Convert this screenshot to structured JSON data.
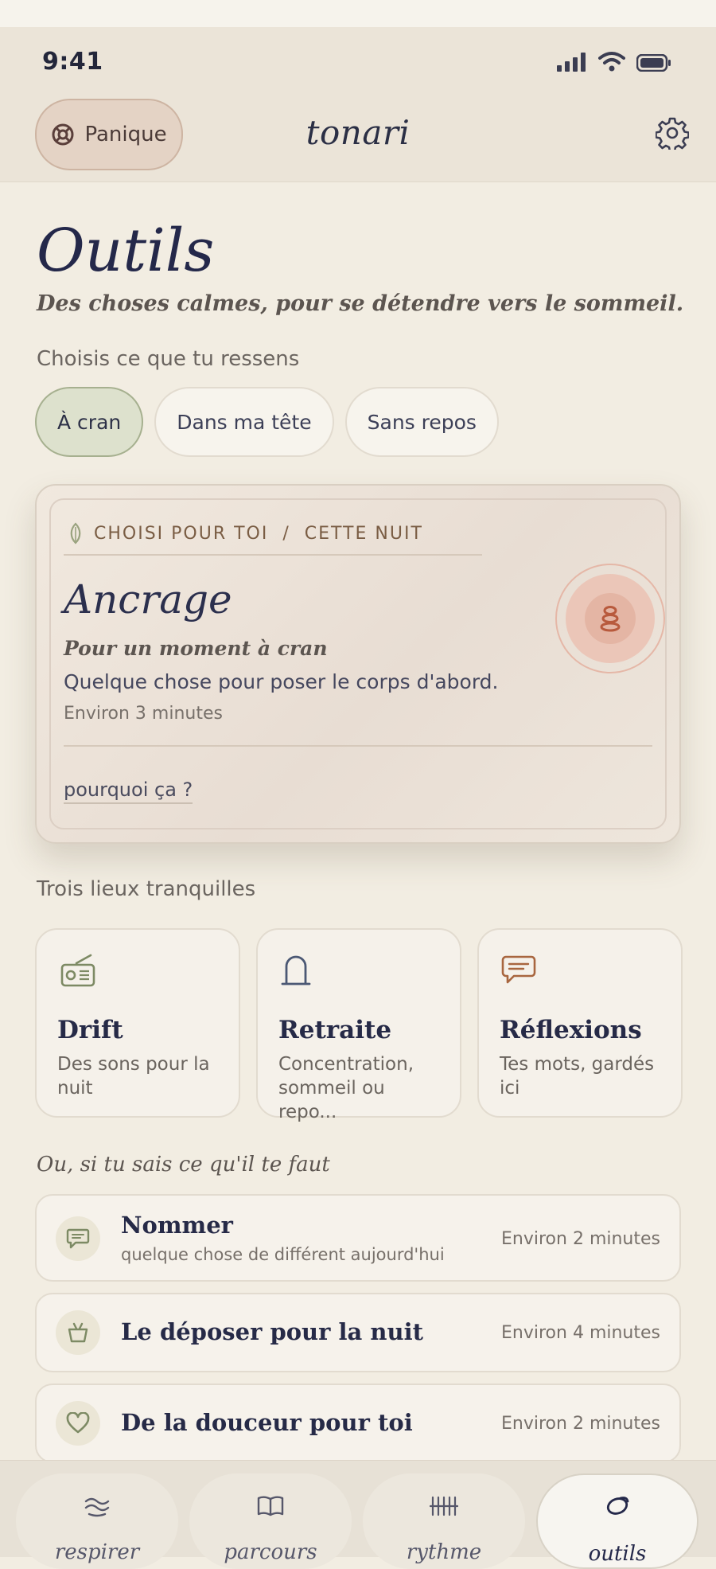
{
  "status": {
    "time": "9:41"
  },
  "header": {
    "panic_label": "Panique",
    "brand": "tonari"
  },
  "page": {
    "title": "Outils",
    "subtitle": "Des choses calmes, pour se détendre vers le sommeil."
  },
  "feelings": {
    "label": "Choisis ce que tu ressens",
    "chips": [
      {
        "label": "À cran",
        "selected": true
      },
      {
        "label": "Dans ma tête",
        "selected": false
      },
      {
        "label": "Sans repos",
        "selected": false
      }
    ]
  },
  "featured": {
    "eyebrow": "CHOISI POUR TOI  /  CETTE NUIT",
    "title": "Ancrage",
    "subtitle": "Pour un moment à cran",
    "description": "Quelque chose pour poser le corps d'abord.",
    "duration": "Environ 3 minutes",
    "why_link": "pourquoi ça ?",
    "icon": "stacked-stones-icon"
  },
  "places": {
    "label": "Trois lieux tranquilles",
    "items": [
      {
        "title": "Drift",
        "desc": "Des sons pour la nuit",
        "icon": "radio-icon"
      },
      {
        "title": "Retraite",
        "desc": "Concentration, sommeil ou repo...",
        "icon": "arch-icon"
      },
      {
        "title": "Réflexions",
        "desc": "Tes mots, gardés ici",
        "icon": "message-icon"
      }
    ]
  },
  "quick": {
    "label": "Ou, si tu sais ce qu'il te faut",
    "items": [
      {
        "title": "Nommer",
        "subtitle": "quelque chose de différent aujourd'hui",
        "duration": "Environ 2 minutes",
        "icon": "chat-bubble-icon"
      },
      {
        "title": "Le déposer pour la nuit",
        "duration": "Environ 4 minutes",
        "icon": "basket-icon"
      },
      {
        "title": "De la douceur pour toi",
        "duration": "Environ 2 minutes",
        "icon": "heart-icon"
      }
    ]
  },
  "tabs": [
    {
      "label": "respirer",
      "icon": "breath-waves-icon",
      "active": false
    },
    {
      "label": "parcours",
      "icon": "open-book-icon",
      "active": false
    },
    {
      "label": "rythme",
      "icon": "rhythm-bars-icon",
      "active": false
    },
    {
      "label": "outils",
      "icon": "loop-icon",
      "active": true
    }
  ],
  "colors": {
    "accent_sage": "#a6b08f",
    "accent_terracotta": "#c0694b",
    "background": "#f2ede2",
    "ink": "#24284a"
  }
}
